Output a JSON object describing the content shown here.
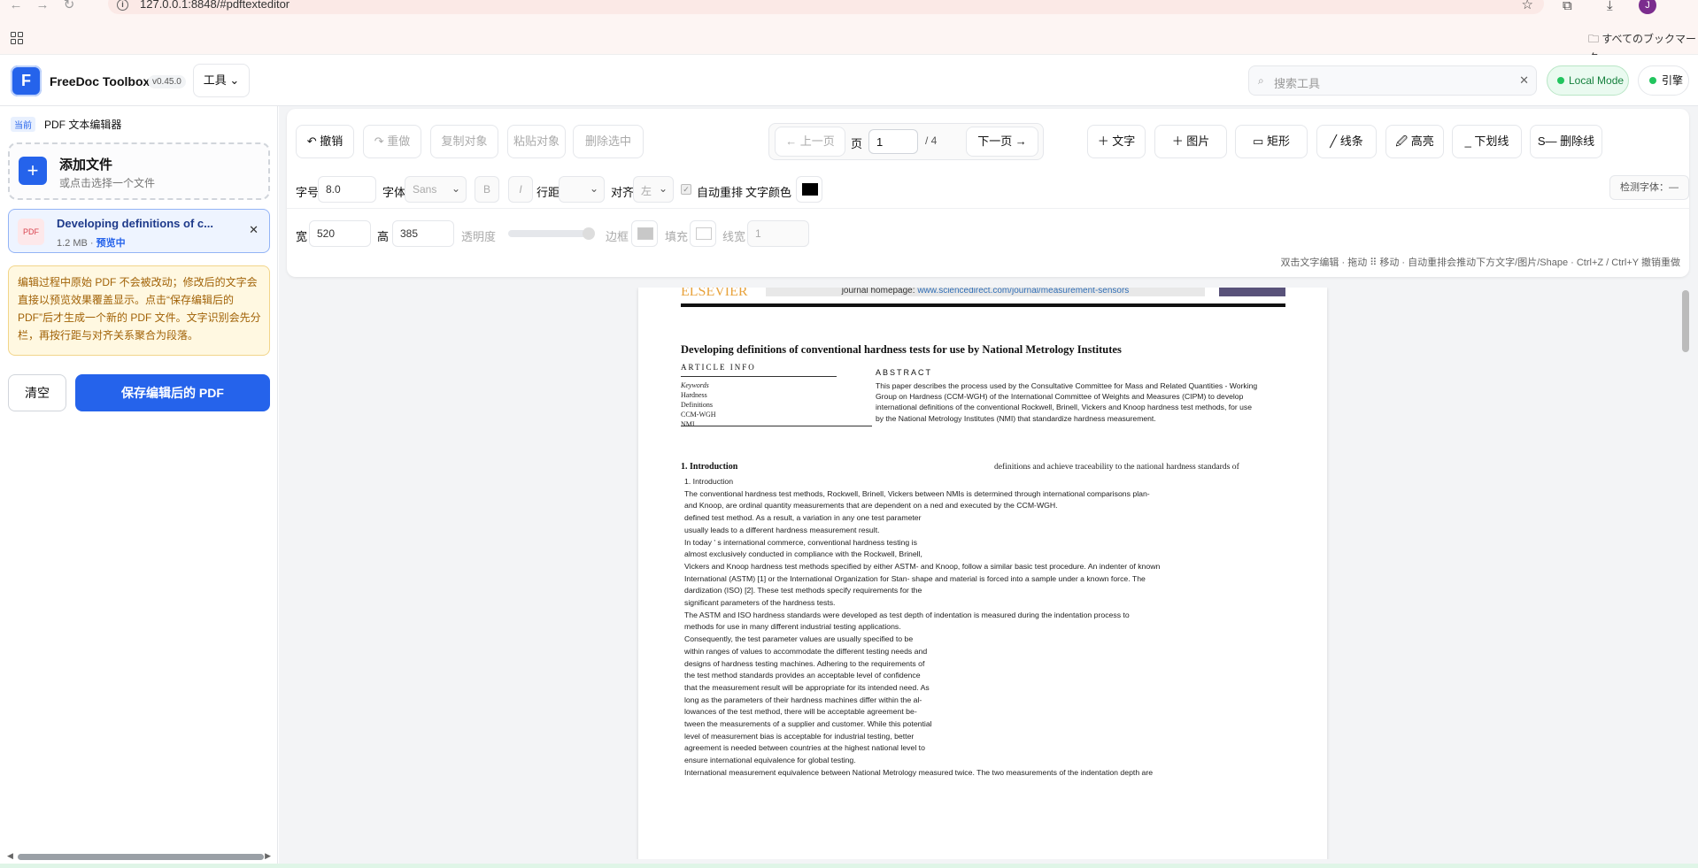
{
  "browser": {
    "url": "127.0.0.1:8848/#pdftexteditor",
    "bookmarks_label": "すべてのブックマーク",
    "profile_initial": "J"
  },
  "header": {
    "brand": "FreeDoc Toolbox",
    "version": "v0.45.0",
    "tools_label": "工具 ⌄",
    "search_placeholder": "搜索工具",
    "local_mode": "Local Mode",
    "engine": "引擎"
  },
  "sidebar": {
    "current_tag": "当前",
    "current_title": "PDF 文本编辑器",
    "add_file_title": "添加文件",
    "add_file_sub": "或点击选择一个文件",
    "file": {
      "icon_label": "PDF",
      "name": "Developing definitions of c...",
      "size": "1.2 MB · ",
      "status": "预览中"
    },
    "notice": "编辑过程中原始 PDF 不会被改动；修改后的文字会直接以预览效果覆盖显示。点击“保存编辑后的 PDF”后才生成一个新的 PDF 文件。文字识别会先分栏，再按行距与对齐关系聚合为段落。",
    "clear_label": "清空",
    "save_label": "保存编辑后的 PDF"
  },
  "toolbar": {
    "undo": "↶ 撤销",
    "redo": "↷ 重做",
    "copy": "复制对象",
    "paste": "粘贴对象",
    "delete": "删除选中",
    "prev_page": "← 上一页",
    "page_label": "页",
    "page_value": "1",
    "page_total": "/ 4",
    "next_page": "下一页 →",
    "add_text": "＋ 文字",
    "add_image": "＋ 图片",
    "rect": "▭ 矩形",
    "line": "╱ 线条",
    "highlight": "🖉 高亮",
    "underline": "_ 下划线",
    "strike": "S— 删除线",
    "font_size_label": "字号",
    "font_size": "8.0",
    "font_label": "字体",
    "font_value": "Sans",
    "bold": "B",
    "italic": "I",
    "line_height_label": "行距",
    "align_label": "对齐",
    "align_value": "左",
    "auto_reflow": "自动重排",
    "text_color_label": "文字颜色",
    "text_color": "#000000",
    "detect_font": "检测字体：—",
    "width_label": "宽",
    "width_value": "520",
    "height_label": "高",
    "height_value": "385",
    "opacity_label": "透明度",
    "border_label": "边框",
    "fill_label": "填充",
    "line_width_label": "线宽",
    "line_width_value": "1",
    "hint": "双击文字编辑 · 拖动 ⠿ 移动 · 自动重排会推动下方文字/图片/Shape · Ctrl+Z / Ctrl+Y 撤销重做"
  },
  "pdf": {
    "publisher": "ELSEVIER",
    "journal_prefix": "journal homepage: ",
    "journal_link": "www.sciencedirect.com/journal/measurement-sensors",
    "title": "Developing definitions of conventional hardness tests for use by National Metrology Institutes",
    "article_info": "ARTICLE INFO",
    "keywords": [
      "Keywords",
      "Hardness",
      "Definitions",
      "CCM-WGH",
      "NMI"
    ],
    "abstract_label": "ABSTRACT",
    "abstract_lines": [
      "This paper describes the process used by the Consultative Committee for Mass and Related Quantities - Working",
      "Group on Hardness (CCM-WGH) of the International Committee of Weights and Measures (CIPM) to develop",
      "international definitions of the conventional Rockwell, Brinell, Vickers and Knoop hardness test methods, for use",
      "by the National Metrology Institutes (NMI) that standardize hardness measurement."
    ],
    "intro_heading": "1.  Introduction",
    "intro_right": "definitions and achieve traceability to the national hardness standards of",
    "body_lines": [
      "1. Introduction",
      "The conventional hardness test methods, Rockwell, Brinell, Vickers between NMIs is determined through international comparisons plan-",
      "and Knoop, are ordinal quantity measurements that are dependent on a ned and executed by the CCM-WGH.",
      "defined test method. As a result, a variation in any one test parameter",
      "usually leads to a different hardness measurement result.",
      "In today ' s international commerce, conventional hardness testing is",
      "almost exclusively conducted in compliance with the Rockwell, Brinell,",
      "Vickers and Knoop hardness test methods specified by either ASTM- and Knoop, follow a similar basic test procedure. An indenter of known",
      "International (ASTM) [1] or the International Organization for Stan- shape and material is forced into a sample under a known force. The",
      "dardization (ISO) [2]. These test methods specify requirements for the",
      "significant parameters of the hardness tests.",
      "The ASTM and ISO hardness standards were developed as test depth of indentation is measured during the indentation process to",
      "methods for use in many different industrial testing applications.",
      "Consequently, the test parameter values are usually specified to be",
      "within ranges of values to accommodate the different testing needs and",
      "designs of hardness testing machines. Adhering to the requirements of",
      "the test method standards provides an acceptable level of confidence",
      "that the measurement result will be appropriate for its intended need. As",
      "long as the parameters of their hardness machines differ within the al-",
      "lowances of the test method, there will be acceptable agreement be-",
      "tween the measurements of a supplier and customer. While this potential",
      "level of measurement bias is acceptable for industrial testing, better",
      "agreement is needed between countries at the highest national level to",
      "ensure international equivalence for global testing.",
      "International measurement equivalence between National Metrology measured twice. The two measurements of the indentation depth are"
    ]
  }
}
